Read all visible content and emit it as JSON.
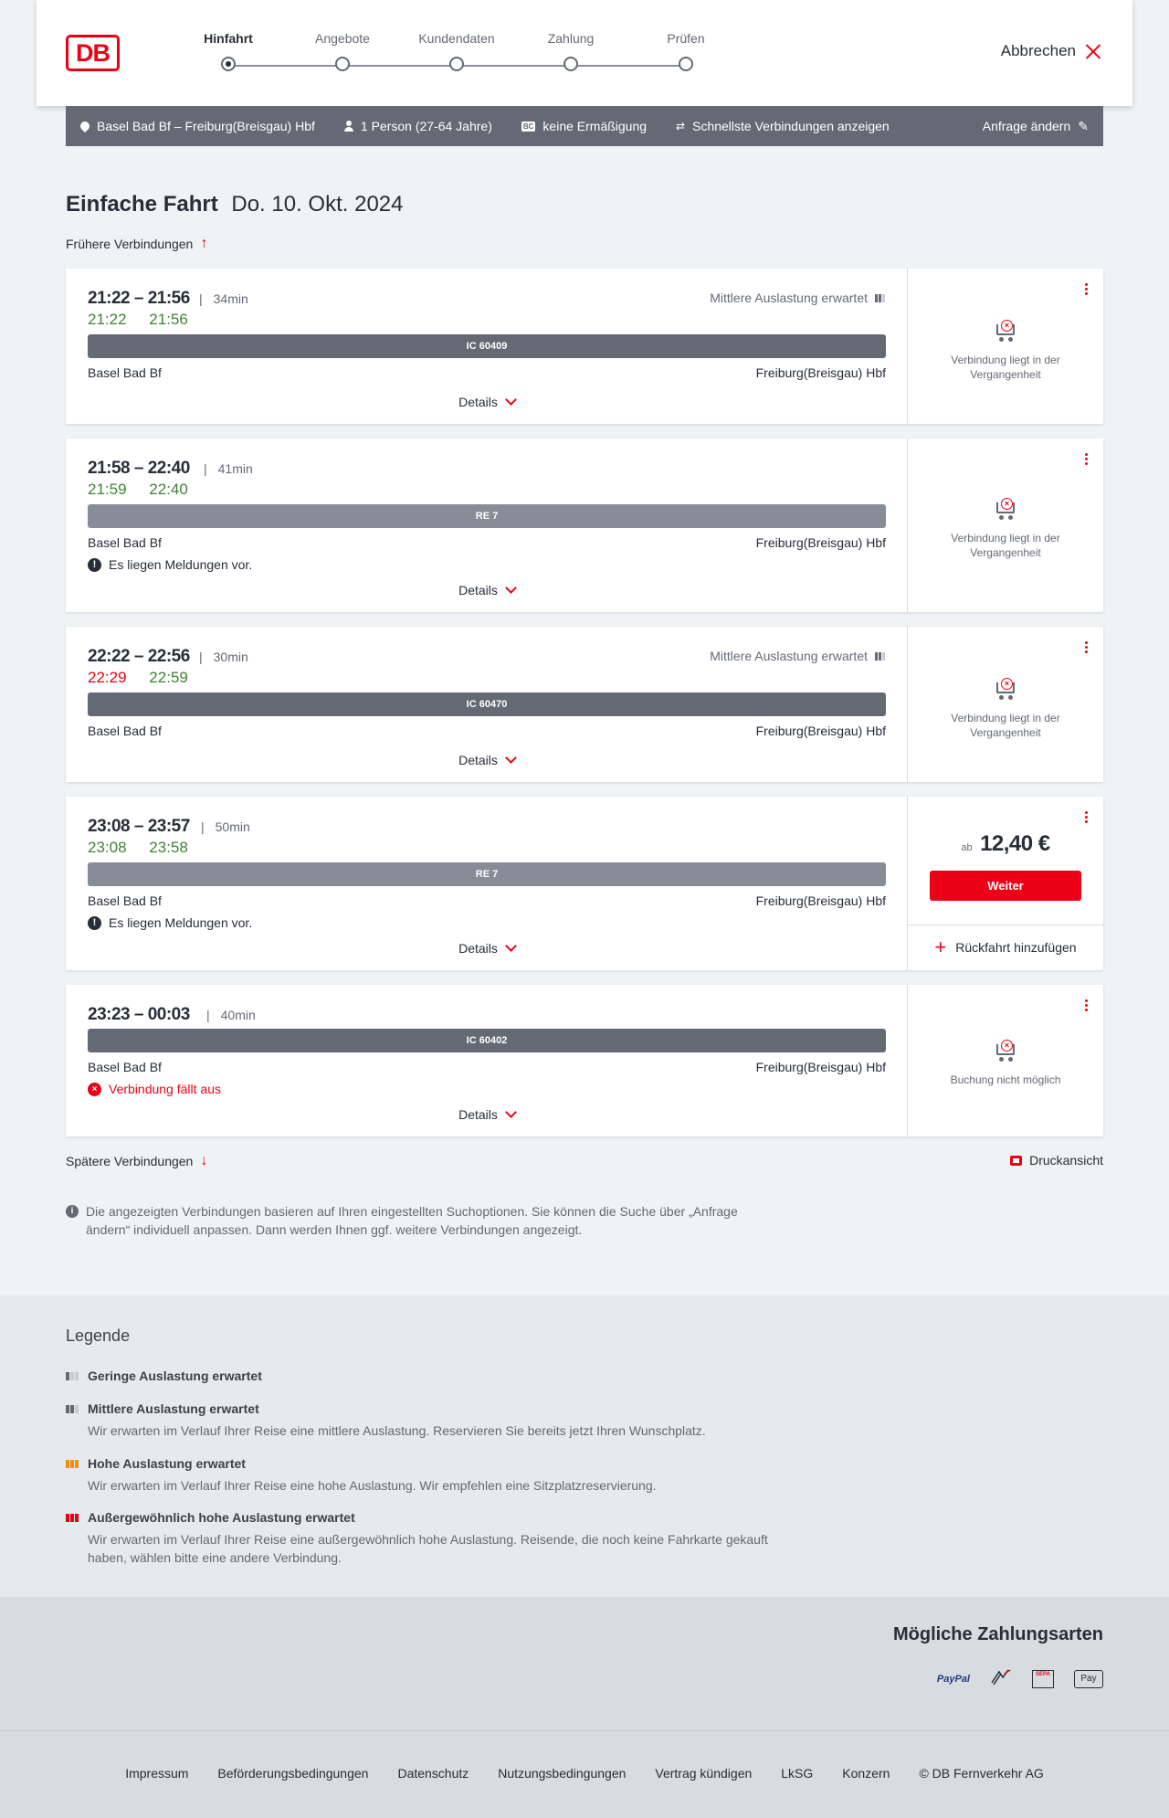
{
  "header": {
    "logo": "DB",
    "steps": [
      "Hinfahrt",
      "Angebote",
      "Kundendaten",
      "Zahlung",
      "Prüfen"
    ],
    "active_step": 0,
    "cancel_label": "Abbrechen"
  },
  "search": {
    "route": "Basel Bad Bf – Freiburg(Breisgau) Hbf",
    "passengers": "1 Person (27-64 Jahre)",
    "discount_badge": "BC",
    "discount": "keine Ermäßigung",
    "fastest": "Schnellste Verbindungen anzeigen",
    "edit_label": "Anfrage ändern"
  },
  "page": {
    "title_bold": "Einfache Fahrt",
    "title_date": "Do. 10. Okt. 2024",
    "earlier_label": "Frühere Verbindungen",
    "later_label": "Spätere Verbindungen",
    "print_label": "Druckansicht",
    "details_label": "Details",
    "info_text": "Die angezeigten Verbindungen basieren auf Ihren eingestellten Suchoptionen. Sie können die Suche über „Anfrage ändern“ individuell anpassen. Dann werden Ihnen ggf. weitere Verbindungen angezeigt."
  },
  "connections": [
    {
      "times": "21:22 – 21:56",
      "duration": "34min",
      "rt_dep": "21:22",
      "rt_arr": "21:56",
      "load": "Mittlere Auslastung erwartet",
      "train": "IC 60409",
      "from": "Basel Bad Bf",
      "to": "Freiburg(Breisgau) Hbf",
      "status": "Verbindung liegt in der Vergangenheit"
    },
    {
      "times": "21:58 – 22:40",
      "duration": "41min",
      "rt_dep": "21:59",
      "rt_arr": "22:40",
      "train": "RE 7",
      "from": "Basel Bad Bf",
      "to": "Freiburg(Breisgau) Hbf",
      "message": "Es liegen Meldungen vor.",
      "status": "Verbindung liegt in der Vergangenheit"
    },
    {
      "times": "22:22 – 22:56",
      "duration": "30min",
      "rt_dep": "22:29",
      "rt_arr": "22:59",
      "load": "Mittlere Auslastung erwartet",
      "train": "IC 60470",
      "from": "Basel Bad Bf",
      "to": "Freiburg(Breisgau) Hbf",
      "status": "Verbindung liegt in der Vergangenheit"
    },
    {
      "times": "23:08 – 23:57",
      "duration": "50min",
      "rt_dep": "23:08",
      "rt_arr": "23:58",
      "train": "RE 7",
      "from": "Basel Bad Bf",
      "to": "Freiburg(Breisgau) Hbf",
      "message": "Es liegen Meldungen vor.",
      "price_prefix": "ab",
      "price": "12,40 €",
      "button": "Weiter",
      "return_label": "Rückfahrt hinzufügen"
    },
    {
      "times": "23:23 – 00:03",
      "duration": "40min",
      "train": "IC 60402",
      "from": "Basel Bad Bf",
      "to": "Freiburg(Breisgau) Hbf",
      "cancelled": "Verbindung fällt aus",
      "status": "Buchung nicht möglich"
    }
  ],
  "legend": {
    "title": "Legende",
    "items": [
      {
        "title": "Geringe Auslastung erwartet"
      },
      {
        "title": "Mittlere Auslastung erwartet",
        "text": "Wir erwarten im Verlauf Ihrer Reise eine mittlere Auslastung. Reservieren Sie bereits jetzt Ihren Wunschplatz."
      },
      {
        "title": "Hohe Auslastung erwartet",
        "text": "Wir erwarten im Verlauf Ihrer Reise eine hohe Auslastung. Wir empfehlen eine Sitzplatzreservierung."
      },
      {
        "title": "Außergewöhnlich hohe Auslastung erwartet",
        "text": "Wir erwarten im Verlauf Ihrer Reise eine außergewöhnlich hohe Auslastung. Reisende, die noch keine Fahrkarte gekauft haben, wählen bitte eine andere Verbindung."
      }
    ]
  },
  "payment": {
    "title": "Mögliche Zahlungsarten",
    "methods": [
      "PayPal",
      "SEPA",
      "Pay"
    ]
  },
  "footer": {
    "links": [
      "Impressum",
      "Beförderungsbedingungen",
      "Datenschutz",
      "Nutzungsbedingungen",
      "Vertrag kündigen",
      "LkSG",
      "Konzern",
      "© DB Fernverkehr AG"
    ]
  },
  "colors": {
    "brand_red": "#ec0016",
    "on_time_green": "#408335",
    "bar_grey": "#646973"
  }
}
